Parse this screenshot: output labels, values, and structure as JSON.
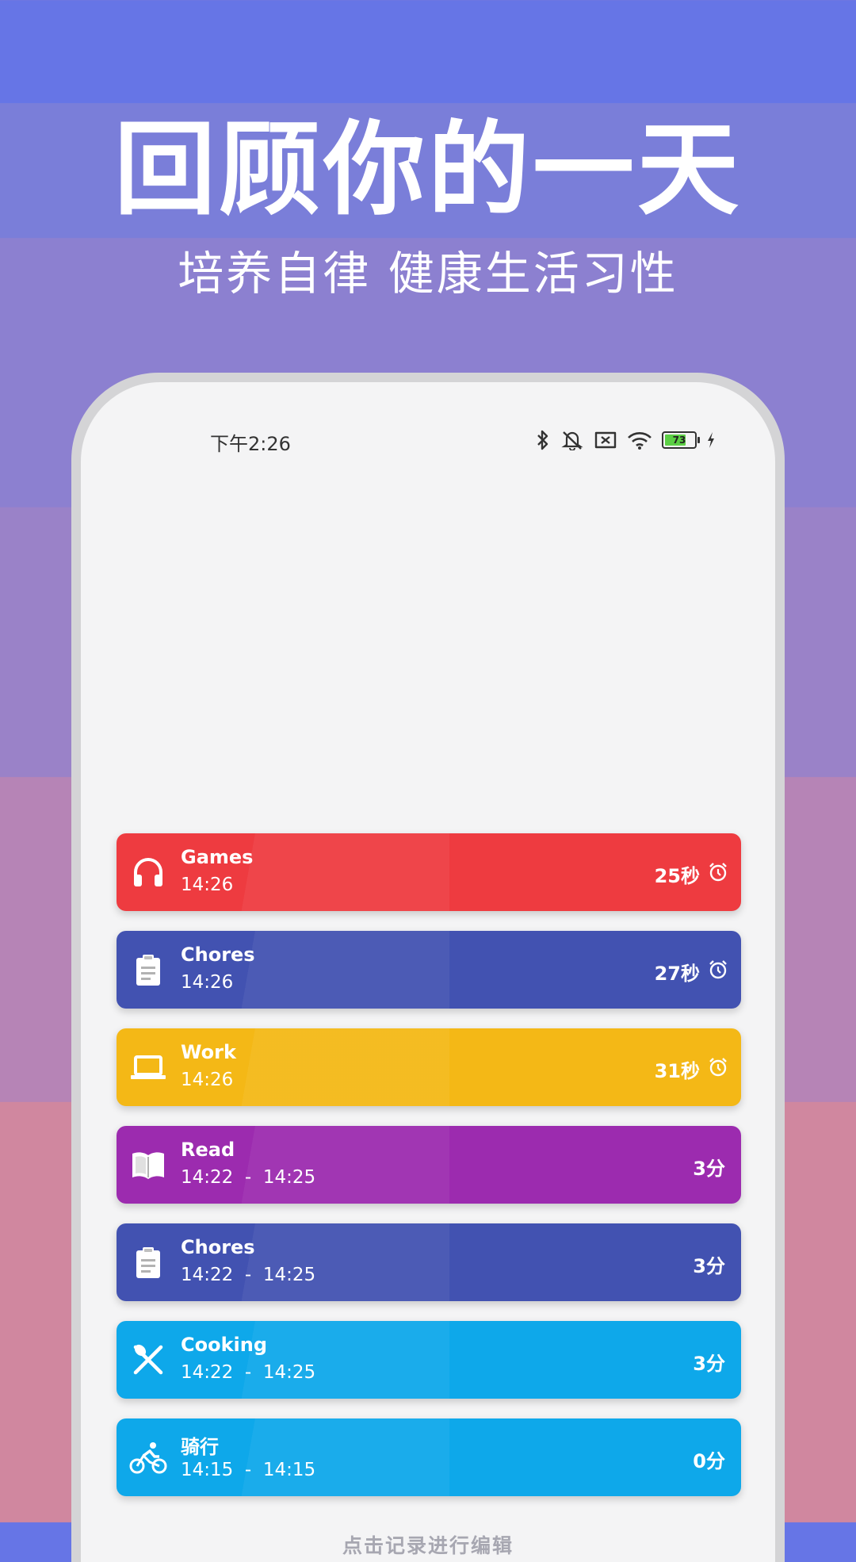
{
  "promo": {
    "headline": "回顾你的一天",
    "subline": "培养自律 健康生活习性"
  },
  "status_bar": {
    "time": "下午2:26",
    "battery": "73"
  },
  "records": [
    {
      "title": "Games",
      "time": "14:26",
      "duration": "25秒",
      "timer": true,
      "color": "#ee3b40",
      "icon": "headphones-icon"
    },
    {
      "title": "Chores",
      "time": "14:26",
      "duration": "27秒",
      "timer": true,
      "color": "#4252b1",
      "icon": "clipboard-icon"
    },
    {
      "title": "Work",
      "time": "14:26",
      "duration": "31秒",
      "timer": true,
      "color": "#f4b816",
      "icon": "laptop-icon"
    },
    {
      "title": "Read",
      "time": "14:22  -  14:25",
      "duration": "3分",
      "timer": false,
      "color": "#9c2baf",
      "icon": "book-icon"
    },
    {
      "title": "Chores",
      "time": "14:22  -  14:25",
      "duration": "3分",
      "timer": false,
      "color": "#4252b1",
      "icon": "clipboard-icon"
    },
    {
      "title": "Cooking",
      "time": "14:22  -  14:25",
      "duration": "3分",
      "timer": false,
      "color": "#0ea8ea",
      "icon": "utensils-icon"
    },
    {
      "title": "骑行",
      "time": "14:15  -  14:15",
      "duration": "0分",
      "timer": false,
      "color": "#0ea8ea",
      "icon": "cyclist-icon"
    }
  ],
  "hint": "点击记录进行编辑"
}
